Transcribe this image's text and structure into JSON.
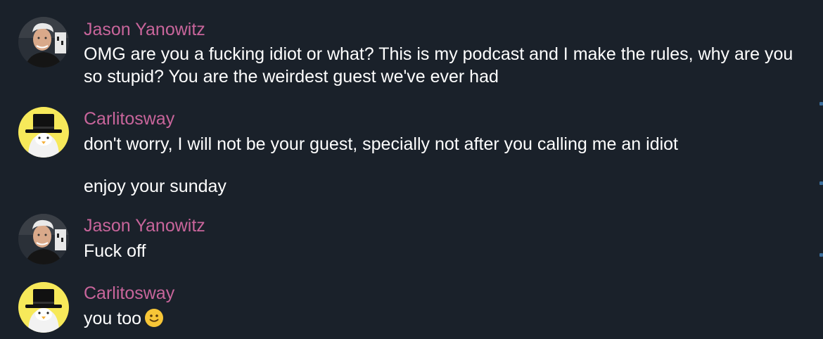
{
  "messages": [
    {
      "sender": "Jason Yanowitz",
      "avatar_icon": "jason-avatar-icon",
      "lines": [
        "OMG are you a fucking idiot or what? This is my podcast and I make the rules, why are you so stupid? You are the weirdest guest we've ever had"
      ]
    },
    {
      "sender": "Carlitosway",
      "avatar_icon": "penguin-top-hat-avatar-icon",
      "lines": [
        "don't worry, I will not be your guest, specially not after you calling me an idiot",
        "enjoy your sunday"
      ]
    },
    {
      "sender": "Jason Yanowitz",
      "avatar_icon": "jason-avatar-icon",
      "lines": [
        "Fuck off"
      ]
    },
    {
      "sender": "Carlitosway",
      "avatar_icon": "penguin-top-hat-avatar-icon",
      "lines": [
        "you too"
      ],
      "emoji": "slightly-smiling-face-emoji"
    }
  ],
  "colors": {
    "background": "#1a212a",
    "sender_name": "#c8659b",
    "message_text": "#ffffff"
  }
}
